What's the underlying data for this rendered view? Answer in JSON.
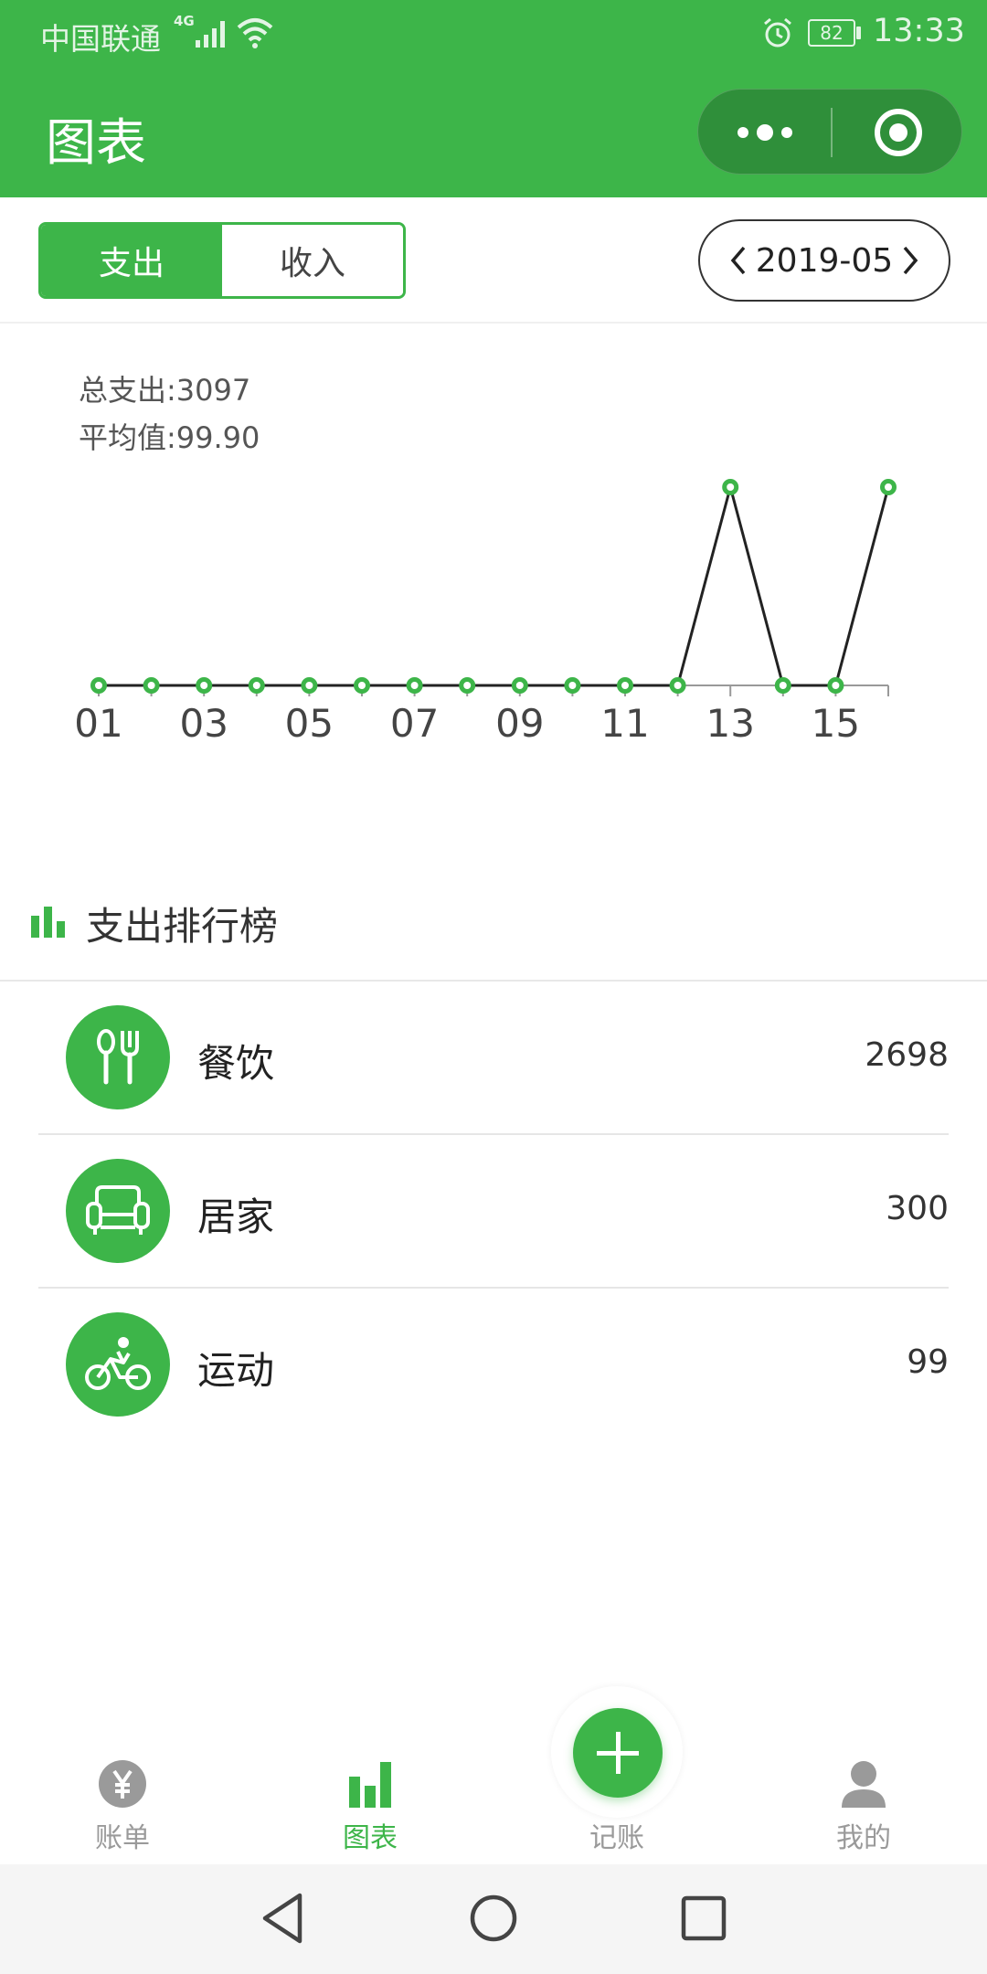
{
  "status_bar": {
    "carrier": "中国联通",
    "network": "4G",
    "battery": "82",
    "time": "13:33"
  },
  "header": {
    "title": "图表",
    "capsule_more_icon": "more-dots-icon",
    "capsule_close_icon": "target-close-icon"
  },
  "toolbar": {
    "tabs": [
      {
        "label": "支出",
        "active": true
      },
      {
        "label": "收入",
        "active": false
      }
    ],
    "month": "2019-05"
  },
  "summary": {
    "total": "总支出:3097",
    "average": "平均值:99.90"
  },
  "chart_data": {
    "type": "line",
    "x": [
      "01",
      "02",
      "03",
      "04",
      "05",
      "06",
      "07",
      "08",
      "09",
      "10",
      "11",
      "12",
      "13",
      "14",
      "15",
      "16"
    ],
    "x_tick_labels": [
      "01",
      "03",
      "05",
      "07",
      "09",
      "11",
      "13",
      "15"
    ],
    "series": [
      {
        "values": [
          0,
          0,
          0,
          0,
          0,
          0,
          0,
          0,
          0,
          0,
          0,
          0,
          2698,
          0,
          0,
          300
        ]
      }
    ],
    "ylim": [
      0,
      300
    ],
    "grid": false,
    "line_color": "#222222",
    "marker_color": "#3db549"
  },
  "ranking": {
    "title": "支出排行榜",
    "items": [
      {
        "name": "餐饮",
        "amount": "2698",
        "icon": "fork-spoon-icon"
      },
      {
        "name": "居家",
        "amount": "300",
        "icon": "sofa-icon"
      },
      {
        "name": "运动",
        "amount": "99",
        "icon": "cycling-icon"
      }
    ]
  },
  "tabbar": {
    "items": [
      {
        "label": "账单",
        "icon": "yen-icon"
      },
      {
        "label": "图表",
        "icon": "bar-chart-icon"
      },
      {
        "label": "记账",
        "icon": "plus-icon"
      },
      {
        "label": "我的",
        "icon": "user-icon"
      }
    ]
  },
  "colors": {
    "primary": "#3db549",
    "primary_dark": "#2f8f3a",
    "inactive": "#9a9a9a"
  }
}
